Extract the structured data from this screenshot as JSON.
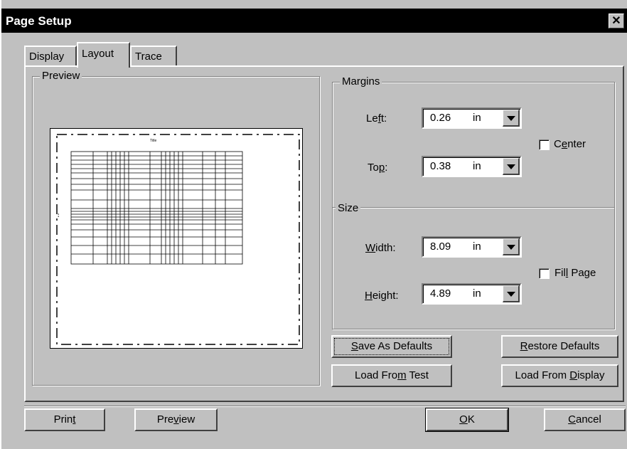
{
  "window": {
    "title": "Page Setup",
    "close_glyph": "✕"
  },
  "tabs": [
    {
      "label": "Display",
      "active": false
    },
    {
      "label": "Layout",
      "active": true
    },
    {
      "label": "Trace",
      "active": false
    }
  ],
  "preview": {
    "group_label": "Preview",
    "mini_title": "Title"
  },
  "margins": {
    "group_label": "Margins",
    "left": {
      "label_pre": "Le",
      "label_key": "f",
      "label_post": "t:",
      "value": "0.26",
      "unit": "in"
    },
    "top": {
      "label_pre": "To",
      "label_key": "p",
      "label_post": ":",
      "value": "0.38",
      "unit": "in"
    },
    "center": {
      "label_pre": "C",
      "label_key": "e",
      "label_post": "nter",
      "checked": false
    }
  },
  "size": {
    "group_label": "Size",
    "width": {
      "label_pre": "",
      "label_key": "W",
      "label_post": "idth:",
      "value": "8.09",
      "unit": "in"
    },
    "height": {
      "label_pre": "",
      "label_key": "H",
      "label_post": "eight:",
      "value": "4.89",
      "unit": "in"
    },
    "fill_page": {
      "label_pre": "Fil",
      "label_key": "l",
      "label_post": " Page",
      "checked": false
    }
  },
  "buttons": {
    "save_defaults": {
      "pre": "",
      "key": "S",
      "post": "ave As Defaults"
    },
    "restore_defaults": {
      "pre": "",
      "key": "R",
      "post": "estore Defaults"
    },
    "load_from_test": {
      "pre": "Load Fro",
      "key": "m",
      "post": " Test"
    },
    "load_from_display": {
      "pre": "Load From ",
      "key": "D",
      "post": "isplay"
    },
    "print": {
      "pre": "Prin",
      "key": "t",
      "post": ""
    },
    "preview": {
      "pre": "Pre",
      "key": "v",
      "post": "iew"
    },
    "ok": {
      "pre": "",
      "key": "O",
      "post": "K"
    },
    "cancel": {
      "pre": "",
      "key": "C",
      "post": "ancel"
    }
  }
}
